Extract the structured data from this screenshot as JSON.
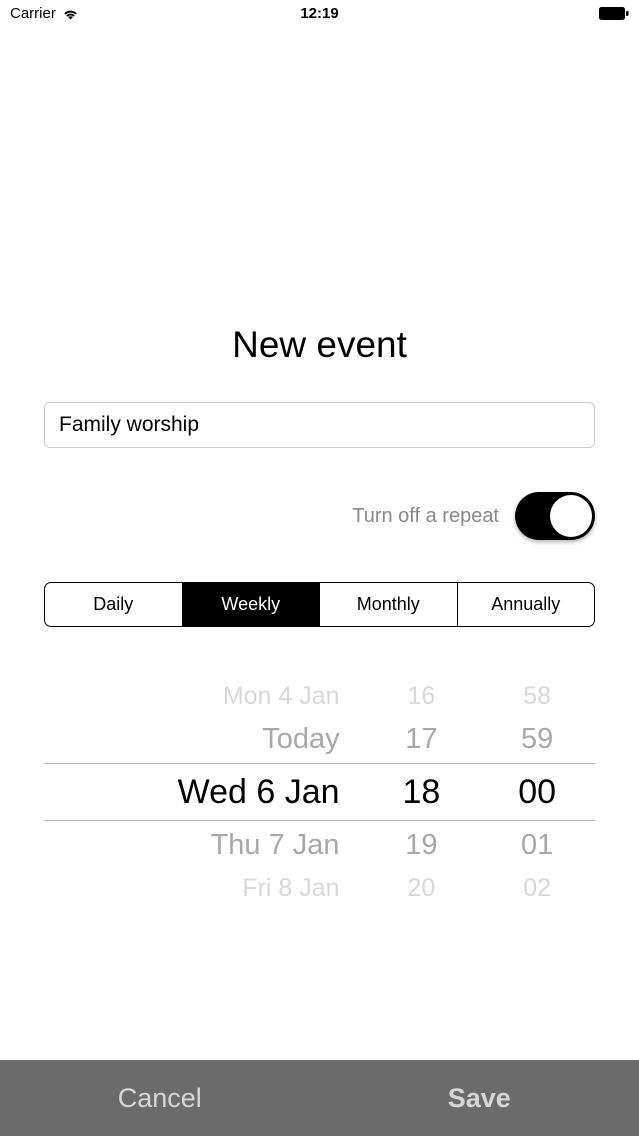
{
  "status": {
    "carrier": "Carrier",
    "time": "12:19"
  },
  "title": "New event",
  "event_name": "Family worship",
  "repeat_label": "Turn off a repeat",
  "segments": {
    "daily": "Daily",
    "weekly": "Weekly",
    "monthly": "Monthly",
    "annually": "Annually"
  },
  "picker": {
    "rows": [
      {
        "date": "Mon 4 Jan",
        "hour": "16",
        "min": "58"
      },
      {
        "date": "Today",
        "hour": "17",
        "min": "59"
      },
      {
        "date": "Wed 6 Jan",
        "hour": "18",
        "min": "00"
      },
      {
        "date": "Thu 7 Jan",
        "hour": "19",
        "min": "01"
      },
      {
        "date": "Fri 8 Jan",
        "hour": "20",
        "min": "02"
      }
    ]
  },
  "buttons": {
    "cancel": "Cancel",
    "save": "Save"
  }
}
